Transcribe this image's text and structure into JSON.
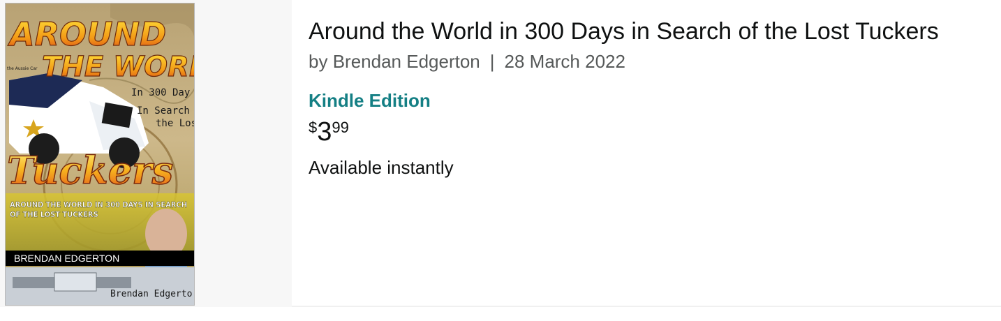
{
  "product": {
    "title": "Around the World in 300 Days in Search of the Lost Tuckers",
    "by_prefix": "by",
    "author": "Brendan Edgerton",
    "separator": "|",
    "date": "28 March 2022",
    "format": "Kindle Edition",
    "price": {
      "symbol": "$",
      "whole": "3",
      "fraction": "99"
    },
    "availability": "Available instantly"
  },
  "cover": {
    "title_line1": "AROUND",
    "title_line2": "THE WORLD",
    "subtitle_line1": "In 300 Day",
    "subtitle_line2": "In Search o",
    "subtitle_line3": "the Los",
    "big_word": "Tuckers",
    "tagline_line1": "AROUND THE WORLD IN 300 DAYS IN SEARCH",
    "tagline_line2": "OF THE LOST TUCKERS",
    "author_band": "BRENDAN EDGERTON",
    "signature": "Brendan Edgerto",
    "car_note": "the Aussie Car"
  },
  "colors": {
    "accent_teal": "#147f84",
    "text_dark": "#0f1111",
    "text_muted": "#565959",
    "panel_bg": "#f7f7f7"
  }
}
